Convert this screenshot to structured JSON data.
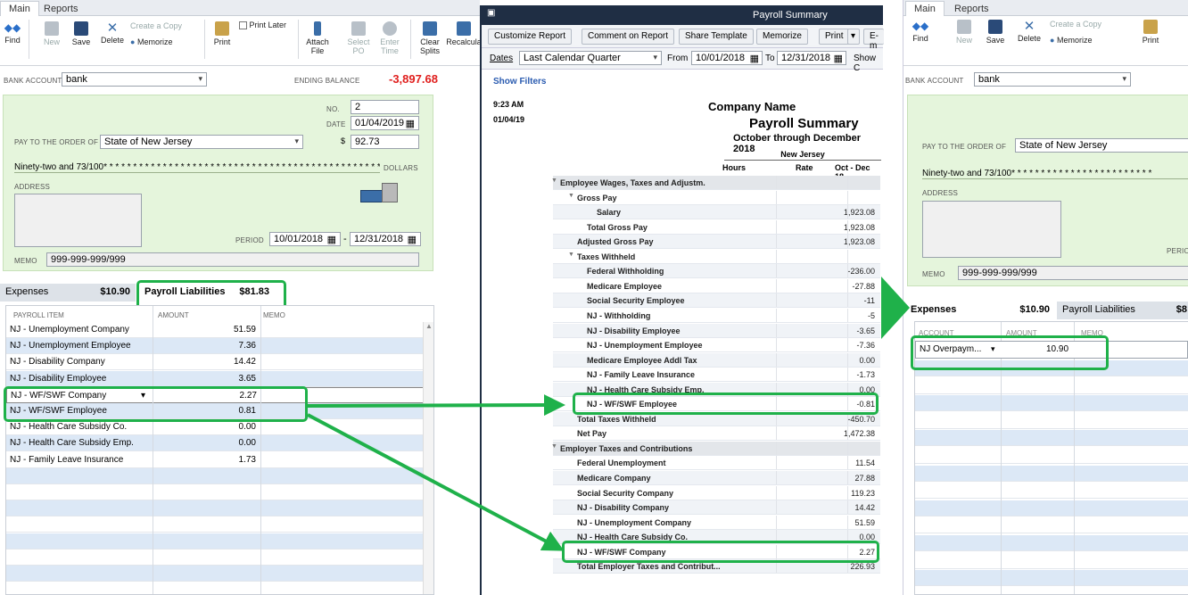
{
  "left": {
    "tabs": [
      "Main",
      "Reports"
    ],
    "toolbar": {
      "find": "Find",
      "new": "New",
      "save": "Save",
      "delete": "Delete",
      "create_copy": "Create a Copy",
      "memorize": "Memorize",
      "print": "Print",
      "print_later": "Print Later",
      "attach_file": "Attach File",
      "select_po": "Select PO",
      "enter_time": "Enter Time",
      "clear_splits": "Clear Splits",
      "recalculate": "Recalcula"
    },
    "bank_account_label": "BANK ACCOUNT",
    "bank_account": "bank",
    "ending_balance_label": "ENDING BALANCE",
    "ending_balance": "-3,897.68",
    "no_label": "NO.",
    "no": "2",
    "date_label": "DATE",
    "date": "01/04/2019",
    "pay_to_label": "PAY TO THE ORDER OF",
    "pay_to": "State of New Jersey",
    "dollar_sign": "$",
    "amount": "92.73",
    "written_amount": "Ninety-two and 73/100* * * * * * * * * * * * * * * * * * * * * * * * * * * * * * * * * * * * * * * * * * * * * * * * * * * * * * * * *",
    "dollars_label": "DOLLARS",
    "address_label": "ADDRESS",
    "period_label": "PERIOD",
    "period_from": "10/01/2018",
    "period_to": "12/31/2018",
    "memo_label": "MEMO",
    "memo": "999-999-999/999",
    "expenses_tab": "Expenses",
    "expenses_amount": "$10.90",
    "liab_tab": "Payroll Liabilities",
    "liab_amount": "$81.83",
    "col_item": "PAYROLL ITEM",
    "col_amount": "AMOUNT",
    "col_memo": "MEMO",
    "rows": [
      {
        "item": "NJ - Unemployment Company",
        "amount": "51.59"
      },
      {
        "item": "NJ - Unemployment Employee",
        "amount": "7.36"
      },
      {
        "item": "NJ - Disability Company",
        "amount": "14.42"
      },
      {
        "item": "NJ - Disability Employee",
        "amount": "3.65"
      },
      {
        "item": "NJ - WF/SWF Company",
        "amount": "2.27"
      },
      {
        "item": "NJ - WF/SWF Employee",
        "amount": "0.81"
      },
      {
        "item": "NJ - Health Care Subsidy Co.",
        "amount": "0.00"
      },
      {
        "item": "NJ - Health Care Subsidy Emp.",
        "amount": "0.00"
      },
      {
        "item": "NJ - Family Leave Insurance",
        "amount": "1.73"
      }
    ]
  },
  "report": {
    "window_title": "Payroll Summary",
    "btn_customize": "Customize Report",
    "btn_comment": "Comment on Report",
    "btn_share": "Share Template",
    "btn_memorize": "Memorize",
    "btn_print": "Print",
    "btn_email": "E-m",
    "dates_label": "Dates",
    "dates_value": "Last Calendar Quarter",
    "from_label": "From",
    "from": "10/01/2018",
    "to_label": "To",
    "to": "12/31/2018",
    "show_c": "Show C",
    "show_filters": "Show Filters",
    "time": "9:23 AM",
    "run_date": "01/04/19",
    "company": "Company Name",
    "title": "Payroll Summary",
    "subtitle": "October through December 2018",
    "state": "New Jersey",
    "col_hours": "Hours",
    "col_rate": "Rate",
    "col_period": "Oct - Dec 18",
    "rows": [
      {
        "name": "Employee Wages, Taxes and Adjustm.",
        "value": "",
        "indent": 0,
        "section": true
      },
      {
        "name": "Gross Pay",
        "value": "",
        "indent": 1,
        "section": false
      },
      {
        "name": "Salary",
        "value": "1,923.08",
        "indent": 3,
        "section": false
      },
      {
        "name": "Total Gross Pay",
        "value": "1,923.08",
        "indent": 2,
        "section": false
      },
      {
        "name": "Adjusted Gross Pay",
        "value": "1,923.08",
        "indent": 1,
        "section": false
      },
      {
        "name": "Taxes Withheld",
        "value": "",
        "indent": 1,
        "section": false
      },
      {
        "name": "Federal Withholding",
        "value": "-236.00",
        "indent": 2,
        "section": false
      },
      {
        "name": "Medicare Employee",
        "value": "-27.88",
        "indent": 2,
        "section": false
      },
      {
        "name": "Social Security Employee",
        "value": "-11",
        "indent": 2,
        "section": false
      },
      {
        "name": "NJ - Withholding",
        "value": "-5",
        "indent": 2,
        "section": false
      },
      {
        "name": "NJ - Disability Employee",
        "value": "-3.65",
        "indent": 2,
        "section": false
      },
      {
        "name": "NJ - Unemployment Employee",
        "value": "-7.36",
        "indent": 2,
        "section": false
      },
      {
        "name": "Medicare Employee Addl Tax",
        "value": "0.00",
        "indent": 2,
        "section": false
      },
      {
        "name": "NJ - Family Leave Insurance",
        "value": "-1.73",
        "indent": 2,
        "section": false
      },
      {
        "name": "NJ - Health Care Subsidy Emp.",
        "value": "0.00",
        "indent": 2,
        "section": false
      },
      {
        "name": "NJ - WF/SWF Employee",
        "value": "-0.81",
        "indent": 2,
        "section": false
      },
      {
        "name": "Total Taxes Withheld",
        "value": "-450.70",
        "indent": 1,
        "section": false
      },
      {
        "name": "Net Pay",
        "value": "1,472.38",
        "indent": 1,
        "section": false
      },
      {
        "name": "Employer Taxes and Contributions",
        "value": "",
        "indent": 0,
        "section": true
      },
      {
        "name": "Federal Unemployment",
        "value": "11.54",
        "indent": 1,
        "section": false
      },
      {
        "name": "Medicare Company",
        "value": "27.88",
        "indent": 1,
        "section": false
      },
      {
        "name": "Social Security Company",
        "value": "119.23",
        "indent": 1,
        "section": false
      },
      {
        "name": "NJ - Disability Company",
        "value": "14.42",
        "indent": 1,
        "section": false
      },
      {
        "name": "NJ - Unemployment Company",
        "value": "51.59",
        "indent": 1,
        "section": false
      },
      {
        "name": "NJ - Health Care Subsidy Co.",
        "value": "0.00",
        "indent": 1,
        "section": false
      },
      {
        "name": "NJ - WF/SWF Company",
        "value": "2.27",
        "indent": 1,
        "section": false
      },
      {
        "name": "Total Employer Taxes and Contribut...",
        "value": "226.93",
        "indent": 1,
        "section": false
      }
    ]
  },
  "right": {
    "tabs": [
      "Main",
      "Reports"
    ],
    "find": "Find",
    "new": "New",
    "save": "Save",
    "delete": "Delete",
    "create_copy": "Create a Copy",
    "memorize": "Memorize",
    "print": "Print",
    "bank_account_label": "BANK ACCOUNT",
    "bank_account": "bank",
    "pay_to_label": "PAY TO THE ORDER OF",
    "pay_to": "State of New Jersey",
    "written_amount": "Ninety-two and 73/100* * * * * * * * * * * * * * * * * * * * * * * *",
    "address_label": "ADDRESS",
    "perio_label": "PERIO",
    "memo_label": "MEMO",
    "memo": "999-999-999/999",
    "expenses_tab": "Expenses",
    "expenses_amount": "$10.90",
    "liab_tab": "Payroll Liabilities",
    "liab_amount": "$8",
    "col_account": "ACCOUNT",
    "col_amount": "AMOUNT",
    "col_memo": "MEMO",
    "row_account": "NJ Overpaym...",
    "row_amount": "10.90"
  },
  "colors": {
    "highlight": "#1fb14a",
    "negative": "#e0201e",
    "check_bg": "#e5f5dc"
  }
}
